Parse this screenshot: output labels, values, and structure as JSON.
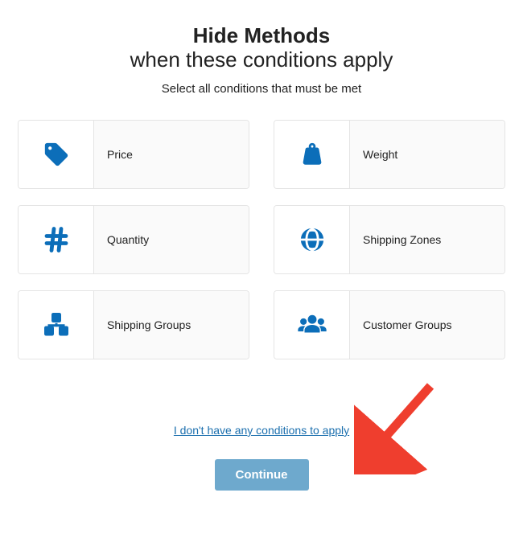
{
  "header": {
    "title": "Hide Methods",
    "subtitle": "when these conditions apply",
    "instruction": "Select all conditions that must be met"
  },
  "conditions": [
    {
      "id": "price",
      "label": "Price",
      "icon": "tag-icon"
    },
    {
      "id": "weight",
      "label": "Weight",
      "icon": "weight-icon"
    },
    {
      "id": "quantity",
      "label": "Quantity",
      "icon": "hash-icon"
    },
    {
      "id": "shipping-zones",
      "label": "Shipping Zones",
      "icon": "globe-icon"
    },
    {
      "id": "shipping-groups",
      "label": "Shipping Groups",
      "icon": "boxes-icon"
    },
    {
      "id": "customer-groups",
      "label": "Customer Groups",
      "icon": "users-icon"
    }
  ],
  "footer": {
    "skip_label": "I don't have any conditions to apply",
    "continue_label": "Continue"
  },
  "colors": {
    "accent": "#0c6eb9",
    "link": "#1b6fae",
    "button": "#6ea9cd",
    "annotation_arrow": "#ef3e2e"
  }
}
